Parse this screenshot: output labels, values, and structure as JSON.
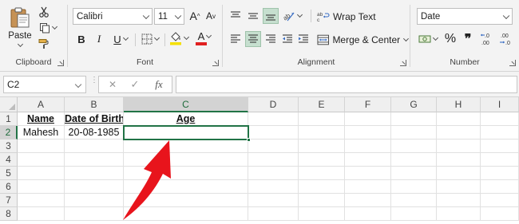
{
  "ribbon": {
    "clipboard": {
      "paste_label": "Paste",
      "group_label": "Clipboard"
    },
    "font": {
      "font_name": "Calibri",
      "font_size": "11",
      "group_label": "Font",
      "bold": "B",
      "italic": "I",
      "underline": "U",
      "grow": "A",
      "shrink": "A",
      "font_color_letter": "A"
    },
    "alignment": {
      "wrap_text_label": "Wrap Text",
      "merge_label": "Merge & Center",
      "group_label": "Alignment"
    },
    "number": {
      "format": "Date",
      "group_label": "Number",
      "percent": "%",
      "comma": "❞",
      "inc_decimal": "←.0\n.00",
      "dec_decimal": ".00\n→.0",
      "highlight_color": "#f5e000",
      "font_color": "#e02020"
    }
  },
  "formula_bar": {
    "name_box": "C2",
    "fx": "fx",
    "cancel": "✕",
    "enter": "✓",
    "content": ""
  },
  "sheet": {
    "columns": [
      "A",
      "B",
      "C",
      "D",
      "E",
      "F",
      "G",
      "H",
      "I"
    ],
    "rows": [
      "1",
      "2",
      "3",
      "4",
      "5",
      "6",
      "7",
      "8"
    ],
    "cells": {
      "A1": "Name",
      "B1": "Date of Birth",
      "C1": "Age",
      "A2": "Mahesh",
      "B2": "20-08-1985",
      "C2": ""
    },
    "active_cell": "C2",
    "accent": "#217346",
    "arrow_color": "#e8141c"
  }
}
